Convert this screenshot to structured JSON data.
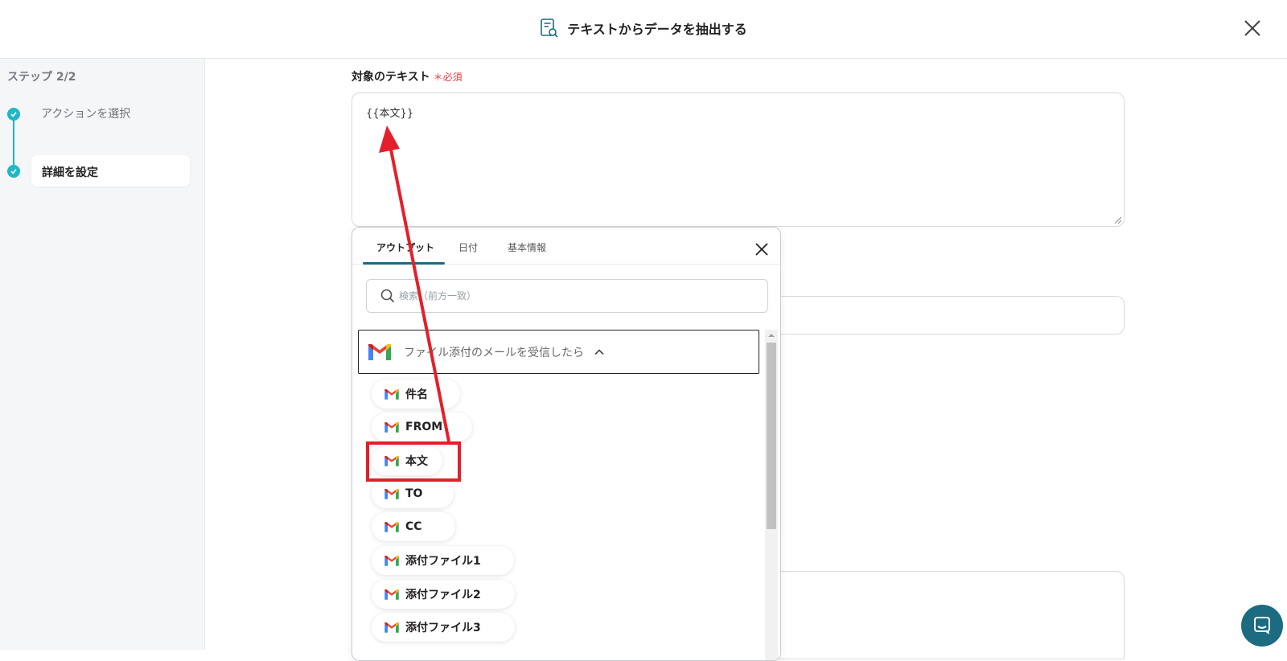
{
  "header": {
    "title": "テキストからデータを抽出する",
    "icon": "document-search-icon",
    "close_icon": "close-icon"
  },
  "sidebar": {
    "step_count": "ステップ 2/2",
    "steps": [
      {
        "label": "アクションを選択",
        "state": "done"
      },
      {
        "label": "詳細を設定",
        "state": "current"
      }
    ],
    "accent_color": "#1fb8c8"
  },
  "form": {
    "target_text_label": "対象のテキスト",
    "required_mark": "＊必須",
    "target_text_value": "{{本文}}"
  },
  "popup": {
    "tabs": [
      {
        "label": "アウトプット",
        "active": true
      },
      {
        "label": "日付",
        "active": false
      },
      {
        "label": "基本情報",
        "active": false
      }
    ],
    "search_placeholder": "検索（前方一致）",
    "group": {
      "label": "ファイル添付のメールを受信したら",
      "expanded": true,
      "icon": "gmail-icon"
    },
    "items": [
      {
        "label": "件名"
      },
      {
        "label": "FROM"
      },
      {
        "label": "本文",
        "highlighted": true
      },
      {
        "label": "TO"
      },
      {
        "label": "CC"
      },
      {
        "label": "添付ファイル1"
      },
      {
        "label": "添付ファイル2"
      },
      {
        "label": "添付ファイル3"
      }
    ]
  },
  "annotation": {
    "color": "#e3202a",
    "type": "arrow-from-highlight-to-textarea"
  },
  "chat": {
    "icon": "chat-icon",
    "color": "#1c6b80"
  }
}
